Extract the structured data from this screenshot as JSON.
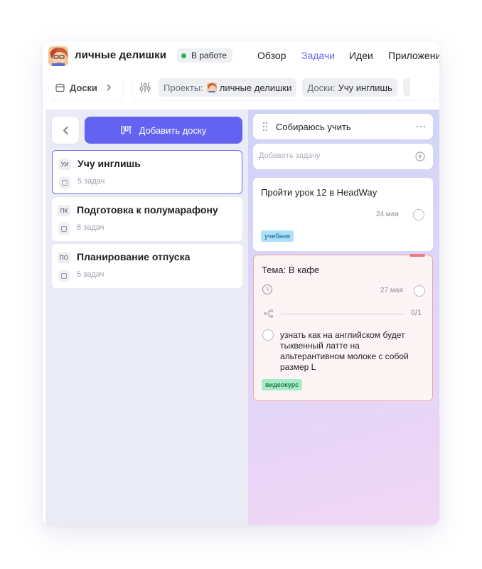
{
  "header": {
    "project_title": "личные делишки",
    "status": "В работе",
    "tabs": [
      {
        "label": "Обзор",
        "active": false
      },
      {
        "label": "Задачи",
        "active": true
      },
      {
        "label": "Идеи",
        "active": false
      },
      {
        "label": "Приложени",
        "active": false
      }
    ]
  },
  "toolbar": {
    "boards_label": "Доски",
    "projects_label": "Проекты:",
    "projects_value": "личные делишки",
    "boards_filter_label": "Доски:",
    "boards_filter_value": "Учу инглишь"
  },
  "left_panel": {
    "add_board_label": "Добавить доску",
    "boards": [
      {
        "abbr": "УИ",
        "name": "Учу инглишь",
        "count": "5 задач",
        "selected": true
      },
      {
        "abbr": "ПК",
        "name": "Подготовка к полумарафону",
        "count": "8 задач",
        "selected": false
      },
      {
        "abbr": "ПО",
        "name": "Планирование отпуска",
        "count": "5 задач",
        "selected": false
      }
    ]
  },
  "column": {
    "title": "Собираюсь учить",
    "add_task_placeholder": "Добавить задачу",
    "tasks": [
      {
        "title": "Пройти урок 12 в HeadWay",
        "date": "24 мая",
        "tag": "учебник"
      },
      {
        "title": "Тема: В кафе",
        "date": "27 мая",
        "progress": "0/1",
        "subtask": "узнать как на английском будет тыквенный латте на альтерантивном молоке с собой размер L",
        "tag": "видеокурс"
      }
    ]
  },
  "colors": {
    "accent": "#6462f1",
    "active_tab": "#6a67f3",
    "status_dot": "#27b35f",
    "alert_border": "#f4a3ab"
  }
}
